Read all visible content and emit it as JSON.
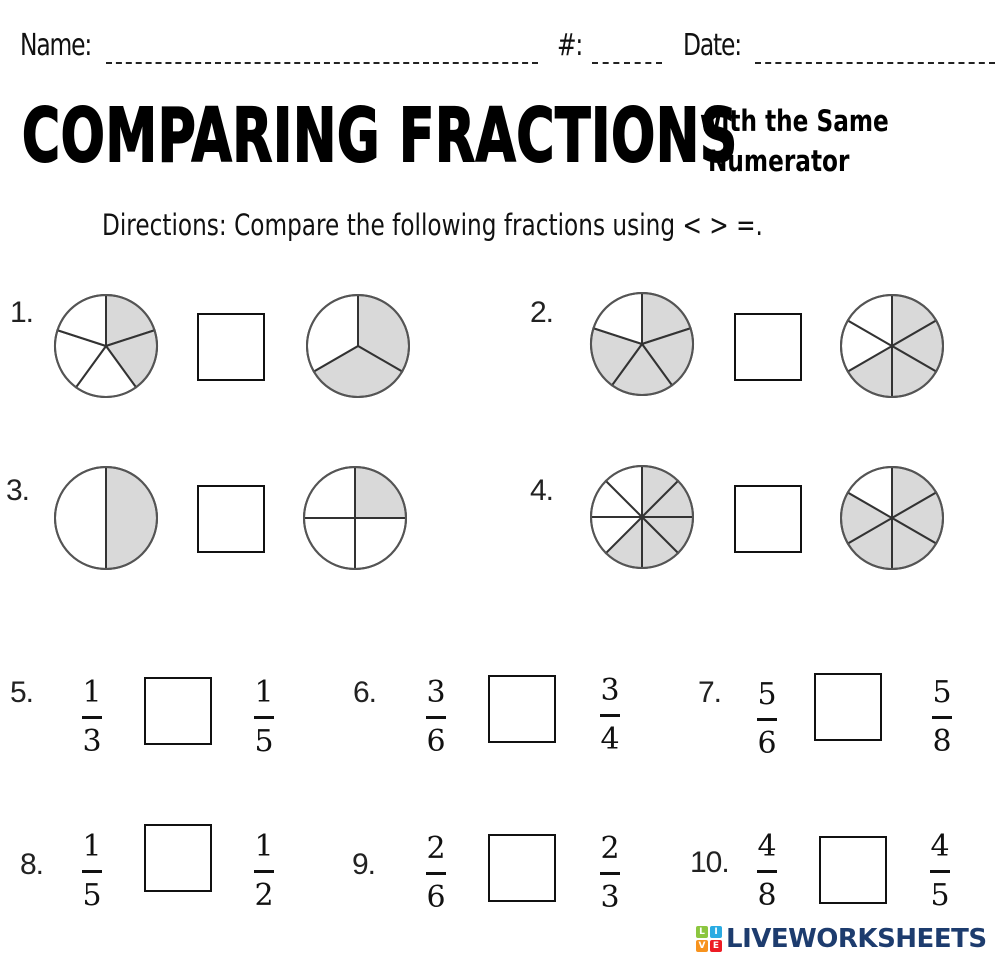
{
  "header": {
    "name_label": "Name:",
    "number_label": "#:",
    "date_label": "Date:"
  },
  "title": {
    "main": "COMPARING FRACTIONS",
    "subtitle_line1": "with the Same",
    "subtitle_line2": "Numerator"
  },
  "directions": "Directions: Compare the following fractions using < > =.",
  "colors": {
    "shade": "#d9d9d9",
    "line": "#333333",
    "logo_text": "#1d3c6e"
  },
  "picture_problems": [
    {
      "label": "1.",
      "left": {
        "parts": 5,
        "shaded": 2
      },
      "right": {
        "parts": 3,
        "shaded": 2
      }
    },
    {
      "label": "2.",
      "left": {
        "parts": 5,
        "shaded": 4
      },
      "right": {
        "parts": 6,
        "shaded": 4
      }
    },
    {
      "label": "3.",
      "left": {
        "parts": 2,
        "shaded": 1
      },
      "right": {
        "parts": 4,
        "shaded": 1
      }
    },
    {
      "label": "4.",
      "left": {
        "parts": 8,
        "shaded": 5
      },
      "right": {
        "parts": 6,
        "shaded": 5
      }
    }
  ],
  "fraction_problems": [
    {
      "label": "5.",
      "left": {
        "num": "1",
        "den": "3"
      },
      "right": {
        "num": "1",
        "den": "5"
      }
    },
    {
      "label": "6.",
      "left": {
        "num": "3",
        "den": "6"
      },
      "right": {
        "num": "3",
        "den": "4"
      }
    },
    {
      "label": "7.",
      "left": {
        "num": "5",
        "den": "6"
      },
      "right": {
        "num": "5",
        "den": "8"
      }
    },
    {
      "label": "8.",
      "left": {
        "num": "1",
        "den": "5"
      },
      "right": {
        "num": "1",
        "den": "2"
      }
    },
    {
      "label": "9.",
      "left": {
        "num": "2",
        "den": "6"
      },
      "right": {
        "num": "2",
        "den": "3"
      }
    },
    {
      "label": "10.",
      "left": {
        "num": "4",
        "den": "8"
      },
      "right": {
        "num": "4",
        "den": "5"
      }
    }
  ],
  "logo": {
    "tiles": [
      "L",
      "I",
      "V",
      "E"
    ],
    "tile_colors": [
      "#8cc63f",
      "#29abe2",
      "#f7931e",
      "#ed1c24"
    ],
    "word": "LIVEWORKSHEETS"
  }
}
